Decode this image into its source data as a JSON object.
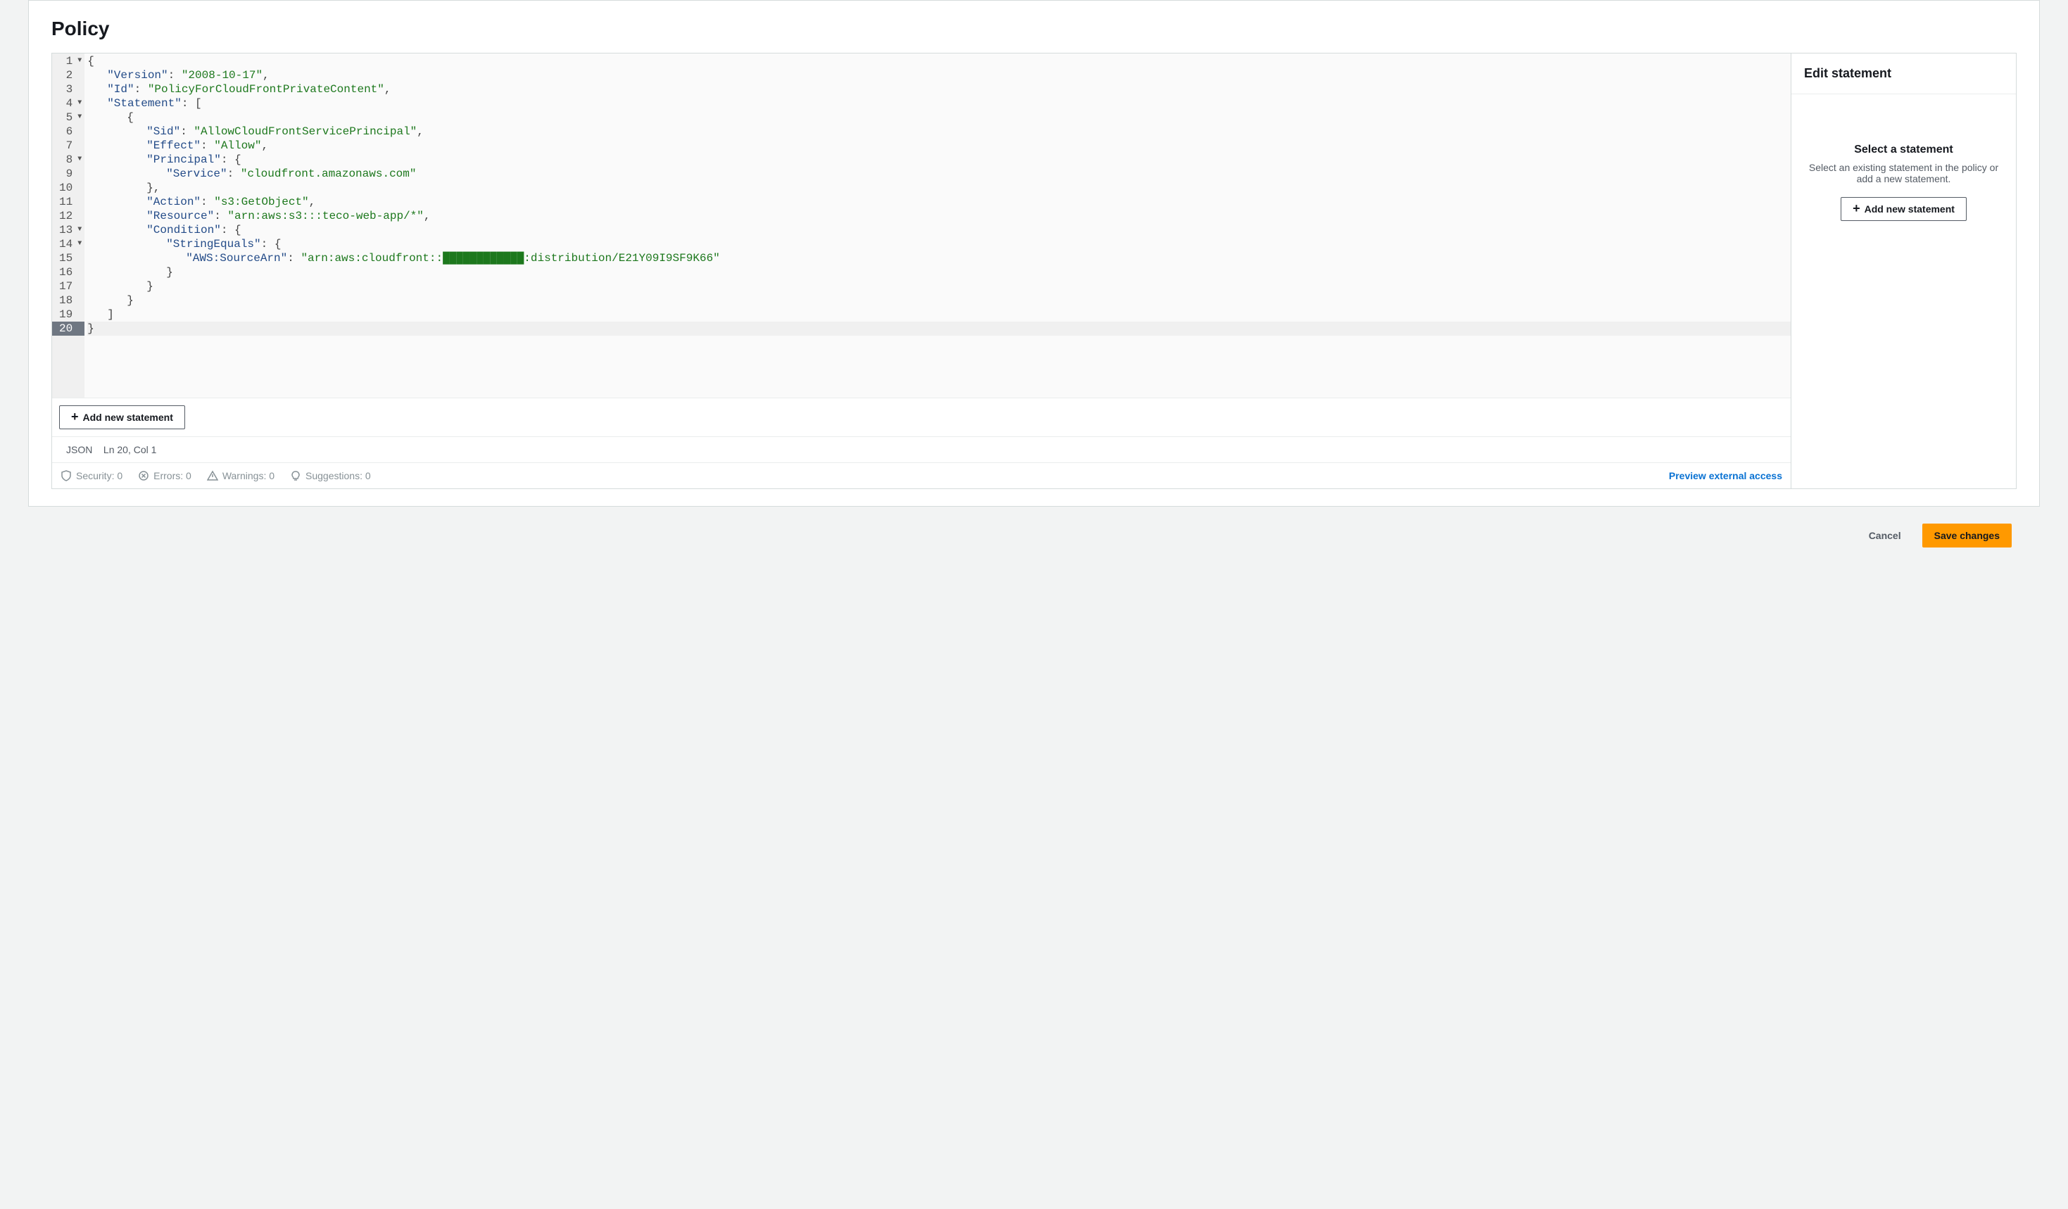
{
  "panel_title": "Policy",
  "editor": {
    "lines": [
      {
        "n": 1,
        "fold": true,
        "html": "<span class='tok-p'>{</span>"
      },
      {
        "n": 2,
        "fold": false,
        "html": "<span class='ind'></span><span class='tok-k'>\"Version\"</span><span class='tok-p'>: </span><span class='tok-s'>\"2008-10-17\"</span><span class='tok-p'>,</span>"
      },
      {
        "n": 3,
        "fold": false,
        "html": "<span class='ind'></span><span class='tok-k'>\"Id\"</span><span class='tok-p'>: </span><span class='tok-s'>\"PolicyForCloudFrontPrivateContent\"</span><span class='tok-p'>,</span>"
      },
      {
        "n": 4,
        "fold": true,
        "html": "<span class='ind'></span><span class='tok-k'>\"Statement\"</span><span class='tok-p'>: [</span>"
      },
      {
        "n": 5,
        "fold": true,
        "html": "<span class='ind'></span><span class='ind'></span><span class='tok-p'>{</span>"
      },
      {
        "n": 6,
        "fold": false,
        "html": "<span class='ind'></span><span class='ind'></span><span class='ind'></span><span class='tok-k'>\"Sid\"</span><span class='tok-p'>: </span><span class='tok-s'>\"AllowCloudFrontServicePrincipal\"</span><span class='tok-p'>,</span>"
      },
      {
        "n": 7,
        "fold": false,
        "html": "<span class='ind'></span><span class='ind'></span><span class='ind'></span><span class='tok-k'>\"Effect\"</span><span class='tok-p'>: </span><span class='tok-s'>\"Allow\"</span><span class='tok-p'>,</span>"
      },
      {
        "n": 8,
        "fold": true,
        "html": "<span class='ind'></span><span class='ind'></span><span class='ind'></span><span class='tok-k'>\"Principal\"</span><span class='tok-p'>: {</span>"
      },
      {
        "n": 9,
        "fold": false,
        "html": "<span class='ind'></span><span class='ind'></span><span class='ind'></span><span class='ind'></span><span class='tok-k'>\"Service\"</span><span class='tok-p'>: </span><span class='tok-s'>\"cloudfront.amazonaws.com\"</span>"
      },
      {
        "n": 10,
        "fold": false,
        "html": "<span class='ind'></span><span class='ind'></span><span class='ind'></span><span class='tok-p'>},</span>"
      },
      {
        "n": 11,
        "fold": false,
        "html": "<span class='ind'></span><span class='ind'></span><span class='ind'></span><span class='tok-k'>\"Action\"</span><span class='tok-p'>: </span><span class='tok-s'>\"s3:GetObject\"</span><span class='tok-p'>,</span>"
      },
      {
        "n": 12,
        "fold": false,
        "html": "<span class='ind'></span><span class='ind'></span><span class='ind'></span><span class='tok-k'>\"Resource\"</span><span class='tok-p'>: </span><span class='tok-s'>\"arn:aws:s3:::teco-web-app/*\"</span><span class='tok-p'>,</span>"
      },
      {
        "n": 13,
        "fold": true,
        "html": "<span class='ind'></span><span class='ind'></span><span class='ind'></span><span class='tok-k'>\"Condition\"</span><span class='tok-p'>: {</span>"
      },
      {
        "n": 14,
        "fold": true,
        "html": "<span class='ind'></span><span class='ind'></span><span class='ind'></span><span class='ind'></span><span class='tok-k'>\"StringEquals\"</span><span class='tok-p'>: {</span>"
      },
      {
        "n": 15,
        "fold": false,
        "html": "<span class='ind'></span><span class='ind'></span><span class='ind'></span><span class='ind'></span><span class='ind'></span><span class='tok-k'>\"AWS:SourceArn\"</span><span class='tok-p'>: </span><span class='tok-s'>\"arn:aws:cloudfront::████████████:distribution/E21Y09I9SF9K66\"</span>"
      },
      {
        "n": 16,
        "fold": false,
        "html": "<span class='ind'></span><span class='ind'></span><span class='ind'></span><span class='ind'></span><span class='tok-p'>}</span>"
      },
      {
        "n": 17,
        "fold": false,
        "html": "<span class='ind'></span><span class='ind'></span><span class='ind'></span><span class='tok-p'>}</span>"
      },
      {
        "n": 18,
        "fold": false,
        "html": "<span class='ind'></span><span class='ind'></span><span class='tok-p'>}</span>"
      },
      {
        "n": 19,
        "fold": false,
        "html": "<span class='ind'></span><span class='tok-p'>]</span>"
      },
      {
        "n": 20,
        "fold": false,
        "current": true,
        "html": "<span class='tok-p'>}</span>"
      }
    ],
    "add_statement_button": "Add new statement",
    "status": {
      "mode": "JSON",
      "cursor": "Ln 20, Col 1"
    },
    "issues": {
      "security": "Security: 0",
      "errors": "Errors: 0",
      "warnings": "Warnings: 0",
      "suggestions": "Suggestions: 0"
    },
    "preview_link": "Preview external access"
  },
  "side": {
    "title": "Edit statement",
    "heading": "Select a statement",
    "body": "Select an existing statement in the policy or add a new statement.",
    "add_button": "Add new statement"
  },
  "footer": {
    "cancel": "Cancel",
    "save": "Save changes"
  }
}
